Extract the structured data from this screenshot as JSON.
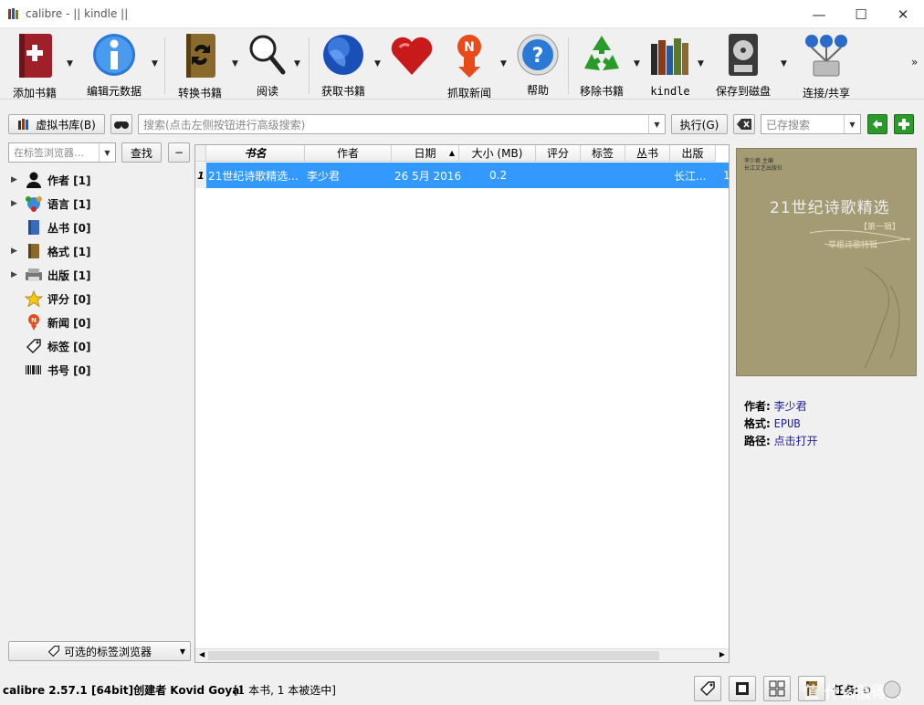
{
  "window": {
    "title": "calibre - || kindle ||"
  },
  "toolbar": {
    "items": [
      {
        "label": "添加书籍",
        "icon": "add-book-icon"
      },
      {
        "label": "编辑元数据",
        "icon": "info-icon"
      },
      {
        "label": "转换书籍",
        "icon": "convert-book-icon"
      },
      {
        "label": "阅读",
        "icon": "magnifier-icon"
      },
      {
        "label": "获取书籍",
        "icon": "globe-icon"
      },
      {
        "label": "",
        "icon": "heart-icon"
      },
      {
        "label": "抓取新闻",
        "icon": "news-icon"
      },
      {
        "label": "帮助",
        "icon": "help-icon"
      },
      {
        "label": "移除书籍",
        "icon": "recycle-icon"
      },
      {
        "label": "kindle",
        "icon": "library-icon"
      },
      {
        "label": "保存到磁盘",
        "icon": "disk-icon"
      },
      {
        "label": "连接/共享",
        "icon": "network-icon"
      }
    ],
    "more": "»"
  },
  "search": {
    "virtual_library": "虚拟书库(B)",
    "placeholder": "搜索(点击左侧按钮进行高级搜索)",
    "execute": "执行(G)",
    "saved_placeholder": "已存搜索"
  },
  "tag_browser": {
    "filter_placeholder": "在标签浏览器…",
    "find": "查找",
    "collapse": "−",
    "items": [
      {
        "label": "作者 [1]",
        "icon": "person-icon",
        "expandable": true
      },
      {
        "label": "语言 [1]",
        "icon": "language-icon",
        "expandable": true
      },
      {
        "label": "丛书 [0]",
        "icon": "series-icon",
        "expandable": false
      },
      {
        "label": "格式 [1]",
        "icon": "format-icon",
        "expandable": true
      },
      {
        "label": "出版 [1]",
        "icon": "publisher-icon",
        "expandable": true
      },
      {
        "label": "评分 [0]",
        "icon": "star-icon",
        "expandable": false
      },
      {
        "label": "新闻 [0]",
        "icon": "news-icon",
        "expandable": false
      },
      {
        "label": "标签 [0]",
        "icon": "tag-icon",
        "expandable": false
      },
      {
        "label": "书号 [0]",
        "icon": "barcode-icon",
        "expandable": false
      }
    ],
    "configure": "可选的标签浏览器"
  },
  "booklist": {
    "columns": [
      "书名",
      "作者",
      "日期",
      "大小 (MB)",
      "评分",
      "标签",
      "丛书",
      "出版"
    ],
    "sort_indicator": "▲",
    "rows": [
      {
        "num": "1",
        "title": "21世纪诗歌精选...",
        "author": "李少君",
        "date": "26 5月 2016",
        "size": "0.2",
        "publisher": "长江...",
        "extra": "1"
      }
    ]
  },
  "details": {
    "cover": {
      "title": "21世纪诗歌精选",
      "sub": "【第一辑】",
      "line": "草根诗歌特辑",
      "top1": "李少君  主编",
      "top2": "长江文艺出版社"
    },
    "author_label": "作者:",
    "author_value": "李少君",
    "format_label": "格式:",
    "format_value": "EPUB",
    "path_label": "路径:",
    "path_value": "点击打开"
  },
  "status": {
    "left": "calibre 2.57.1 [64bit]创建者 Kovid Goyal",
    "count": "[1 本书, 1 本被选中]",
    "jobs": "任务: 0",
    "watermark": "值 什么值得买"
  }
}
